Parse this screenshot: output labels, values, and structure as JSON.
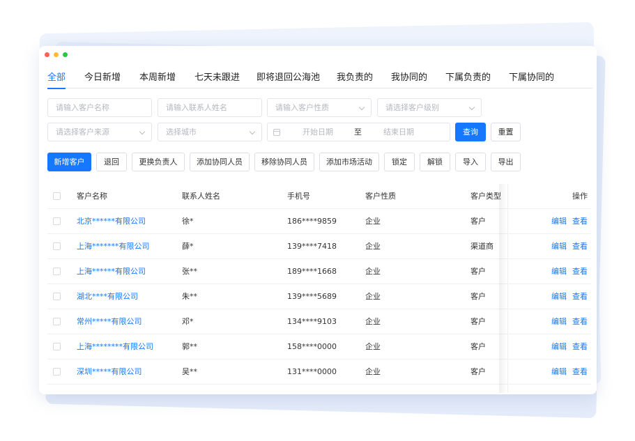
{
  "window_dots": [
    "#ff5f57",
    "#febc2e",
    "#28c840"
  ],
  "tabs": [
    {
      "label": "全部",
      "active": true
    },
    {
      "label": "今日新增"
    },
    {
      "label": "本周新增"
    },
    {
      "label": "七天未跟进"
    },
    {
      "label": "即将退回公海池"
    },
    {
      "label": "我负责的"
    },
    {
      "label": "我协同的"
    },
    {
      "label": "下属负责的"
    },
    {
      "label": "下属协同的"
    }
  ],
  "filters": {
    "customer_name_placeholder": "请输入客户名称",
    "contact_name_placeholder": "请输入联系人姓名",
    "customer_nature_placeholder": "请输入客户性质",
    "customer_level_placeholder": "请选择客户级别",
    "customer_source_placeholder": "请选择客户来源",
    "city_placeholder": "选择城市",
    "start_date_placeholder": "开始日期",
    "date_separator": "至",
    "end_date_placeholder": "结束日期",
    "query_label": "查询",
    "reset_label": "重置"
  },
  "actions": {
    "new_customer": "新增客户",
    "return": "退回",
    "change_owner": "更换负责人",
    "add_collaborator": "添加协同人员",
    "remove_collaborator": "移除协同人员",
    "add_campaign": "添加市场活动",
    "lock": "锁定",
    "unlock": "解锁",
    "import": "导入",
    "export": "导出"
  },
  "table": {
    "headers": {
      "name": "客户名称",
      "contact": "联系人姓名",
      "phone": "手机号",
      "nature": "客户性质",
      "type": "客户类型",
      "ops": "操作"
    },
    "edit_label": "编辑",
    "view_label": "查看",
    "rows": [
      {
        "name": "北京******有限公司",
        "contact": "徐*",
        "phone": "186****9859",
        "nature": "企业",
        "type": "客户"
      },
      {
        "name": "上海*******有限公司",
        "contact": "薛*",
        "phone": "139****7418",
        "nature": "企业",
        "type": "渠道商"
      },
      {
        "name": "上海******有限公司",
        "contact": "张**",
        "phone": "189****1668",
        "nature": "企业",
        "type": "客户"
      },
      {
        "name": "湖北****有限公司",
        "contact": "朱**",
        "phone": "139****5689",
        "nature": "企业",
        "type": "客户"
      },
      {
        "name": "常州*****有限公司",
        "contact": "邓*",
        "phone": "134****9103",
        "nature": "企业",
        "type": "客户"
      },
      {
        "name": "上海********有限公司",
        "contact": "郭**",
        "phone": "158****0000",
        "nature": "企业",
        "type": "客户"
      },
      {
        "name": "深圳*****有限公司",
        "contact": "吴**",
        "phone": "131****0000",
        "nature": "企业",
        "type": "客户"
      }
    ]
  }
}
